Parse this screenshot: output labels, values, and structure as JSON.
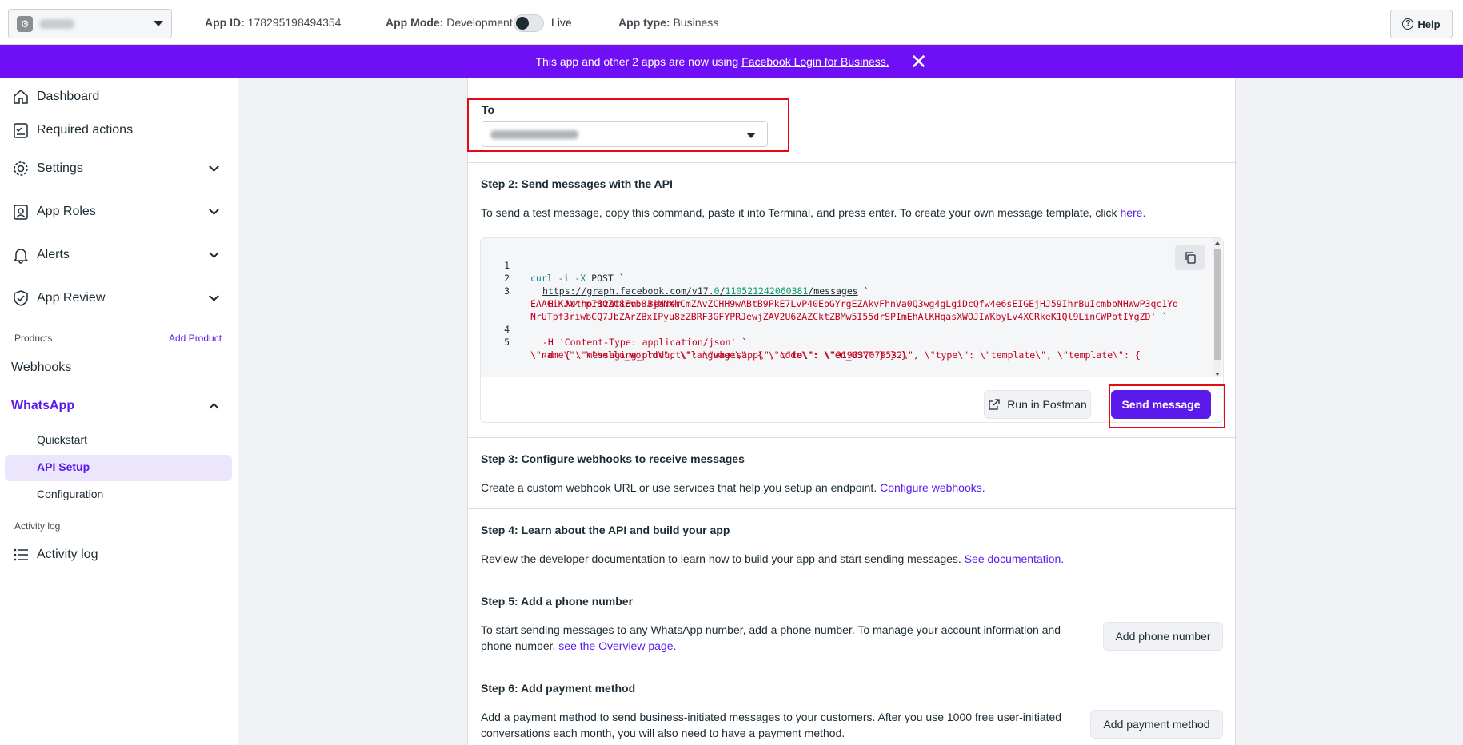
{
  "header": {
    "app_id_label": "App ID:",
    "app_id_value": "178295198494354",
    "app_mode_label": "App Mode:",
    "app_mode_value": "Development",
    "live_label": "Live",
    "app_type_label": "App type:",
    "app_type_value": "Business",
    "help_label": "Help"
  },
  "banner": {
    "text": "This app and other 2 apps are now using",
    "link_text": "Facebook Login for Business."
  },
  "sidebar": {
    "dashboard": "Dashboard",
    "required_actions": "Required actions",
    "settings": "Settings",
    "app_roles": "App Roles",
    "alerts": "Alerts",
    "app_review": "App Review",
    "products_label": "Products",
    "add_product": "Add Product",
    "webhooks": "Webhooks",
    "whatsapp": "WhatsApp",
    "quickstart": "Quickstart",
    "api_setup": "API Setup",
    "configuration": "Configuration",
    "activity_log_label": "Activity log",
    "activity_log": "Activity log"
  },
  "to_field": {
    "label": "To"
  },
  "step2": {
    "title": "Step 2: Send messages with the API",
    "text": "To send a test message, copy this command, paste it into Terminal, and press enter. To create your own message template, click",
    "link": "here."
  },
  "code": {
    "lines": [
      {
        "num": "1",
        "a": "curl -i -X",
        "b": " POST `"
      },
      {
        "num": "2",
        "a": "https://graph.facebook.com/v17.",
        "ver": "0",
        "sep": "/",
        "id": "110521242060381",
        "c": "/messages",
        "d": " `"
      },
      {
        "num": "3",
        "a": "-H 'Authorization: Bearer"
      },
      {
        "num": "",
        "a": "EAACiKJX4rpIBOZC8Evb8JjMNXhCmZAvZCHH9wABtB9PkE7LvP40EpGYrgEZAkvFhnVa0Q3wg4gLgiDcQfw4e6sEIGEjHJ59IhrBuIcmbbNHWwP3qc1Yd"
      },
      {
        "num": "",
        "a": "NrUTpf3riwbCQ7JbZArZBxIPyu8zZBRF3GFYPRJewjZAV2U6ZAZCktZBMw5I55drSPImEhAlKHqasXWOJIWKbyLv4XCRkeK1Ql9LinCWPbtIYgZD'",
        "b": " `"
      },
      {
        "num": "4",
        "a": "-H 'Content-Type: application/json'",
        "b": " `"
      },
      {
        "num": "5",
        "a": "-d '{ \\\"messaging_product\\\": \\\"whatsapp\\\", \\\"to\\\": \\\"919037076532\\\", \\\"type\\\": \\\"template\\\", \\\"template\\\": {"
      },
      {
        "num": "",
        "a": "\\\"name\\\": \\\"hello_world\\\", \\\"language\\\": { \\\"code\\\": \\\"en_US\\\" } } }'"
      }
    ],
    "run_in_postman": "Run in Postman",
    "send_message": "Send message"
  },
  "step3": {
    "title": "Step 3: Configure webhooks to receive messages",
    "text": "Create a custom webhook URL or use services that help you setup an endpoint.",
    "link": "Configure webhooks."
  },
  "step4": {
    "title": "Step 4: Learn about the API and build your app",
    "text": "Review the developer documentation to learn how to build your app and start sending messages.",
    "link": "See documentation."
  },
  "step5": {
    "title": "Step 5: Add a phone number",
    "text_line1": "To start sending messages to any WhatsApp number, add a phone number. To manage your account information and",
    "text_line2": "phone number,",
    "link": "see the Overview page.",
    "button": "Add phone number"
  },
  "step6": {
    "title": "Step 6: Add payment method",
    "text_line1": "Add a payment method to send business-initiated messages to your customers. After you use 1000 free user-initiated",
    "text_line2": "conversations each month, you will also need to have a payment method.",
    "button": "Add payment method"
  },
  "colors": {
    "brand": "#5b1aec",
    "banner": "#6e0ff5",
    "highlight": "#e50914"
  }
}
